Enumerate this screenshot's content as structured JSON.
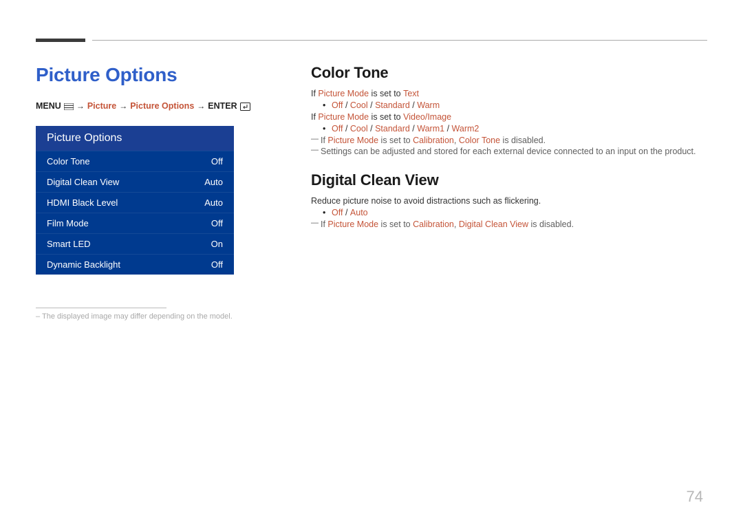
{
  "page": {
    "number": "74",
    "title": "Picture Options",
    "breadcrumb": {
      "label_menu": "MENU",
      "path1": "Picture",
      "path2": "Picture Options",
      "label_enter": "ENTER"
    },
    "panel": {
      "header": "Picture Options",
      "rows": [
        {
          "label": "Color Tone",
          "value": "Off"
        },
        {
          "label": "Digital Clean View",
          "value": "Auto"
        },
        {
          "label": "HDMI Black Level",
          "value": "Auto"
        },
        {
          "label": "Film Mode",
          "value": "Off"
        },
        {
          "label": "Smart LED",
          "value": "On"
        },
        {
          "label": "Dynamic Backlight",
          "value": "Off"
        }
      ]
    },
    "disclaimer": "The displayed image may differ depending on the model."
  },
  "sections": {
    "color_tone": {
      "heading": "Color Tone",
      "cond1_prefix": "If ",
      "cond1_mode": "Picture Mode",
      "cond1_mid": " is set to ",
      "cond1_target": "Text",
      "opts1": {
        "a": "Off",
        "b": "Cool",
        "c": "Standard",
        "d": "Warm"
      },
      "cond2_prefix": "If ",
      "cond2_mode": "Picture Mode",
      "cond2_mid": " is set to ",
      "cond2_target": "Video/Image",
      "opts2": {
        "a": "Off",
        "b": "Cool",
        "c": "Standard",
        "d": "Warm1",
        "e": "Warm2"
      },
      "note1_a": "If ",
      "note1_pm": "Picture Mode",
      "note1_b": " is set to ",
      "note1_cal": "Calibration",
      "note1_c": ", ",
      "note1_ct": "Color Tone",
      "note1_d": " is disabled.",
      "note2": "Settings can be adjusted and stored for each external device connected to an input on the product."
    },
    "dcv": {
      "heading": "Digital Clean View",
      "desc": "Reduce picture noise to avoid distractions such as flickering.",
      "opts": {
        "a": "Off",
        "b": "Auto"
      },
      "note_a": "If ",
      "note_pm": "Picture Mode",
      "note_b": " is set to ",
      "note_cal": "Calibration",
      "note_c": ", ",
      "note_dcv": "Digital Clean View",
      "note_d": " is disabled."
    }
  }
}
